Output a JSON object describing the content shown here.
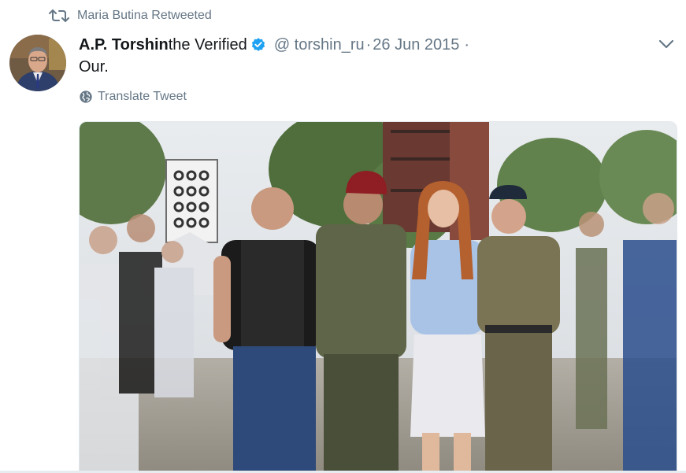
{
  "retweet": {
    "icon": "retweet-icon",
    "label": "Maria Butina Retweeted"
  },
  "tweet": {
    "author_name": "A.P. Torshin",
    "author_suffix": "the Verified",
    "verified_icon": "verified-badge-icon",
    "handle": "@ torshin_ru",
    "separator": "·",
    "timestamp": "26 Jun 2015",
    "trailing_separator": "·",
    "text": "Our.",
    "translate_label": "Translate Tweet",
    "translate_icon": "globe-icon",
    "menu_icon": "chevron-down-icon"
  },
  "colors": {
    "secondary_text": "#657786",
    "primary_text": "#14171a",
    "verified_blue": "#1da1f2",
    "border": "#e1e8ed"
  }
}
